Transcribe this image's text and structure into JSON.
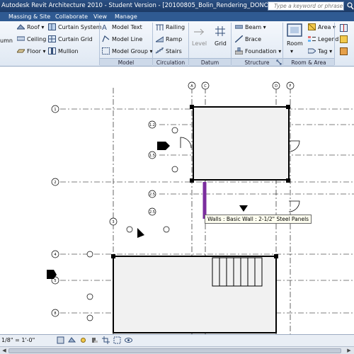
{
  "window": {
    "title": "Autodesk Revit Architecture 2010 - Student Version - [20100805_Bolin_Rendering_DONOTUSE - Structura",
    "search_placeholder": "Type a keyword or phrase"
  },
  "tabs": [
    {
      "label": "Massing & Site"
    },
    {
      "label": "Collaborate"
    },
    {
      "label": "View"
    },
    {
      "label": "Manage"
    }
  ],
  "ribbon": {
    "build": {
      "column": "umn",
      "roof": "Roof",
      "ceiling": "Ceiling",
      "floor": "Floor",
      "curtain_system": "Curtain System",
      "curtain_grid": "Curtain Grid",
      "mullion": "Mullion"
    },
    "model": {
      "model_text": "Model Text",
      "model_line": "Model Line",
      "model_group": "Model Group",
      "label": "Model"
    },
    "circulation": {
      "railing": "Railing",
      "ramp": "Ramp",
      "stairs": "Stairs",
      "label": "Circulation"
    },
    "datum": {
      "level": "Level",
      "grid": "Grid",
      "label": "Datum"
    },
    "structure": {
      "beam": "Beam",
      "brace": "Brace",
      "foundation": "Foundation",
      "label": "Structure"
    },
    "room_area": {
      "room": "Room",
      "area": "Area",
      "legend": "Legend",
      "tag": "Tag",
      "label": "Room & Area"
    }
  },
  "canvas": {
    "tooltip": "Walls : Basic Wall : 2-1/2\" Steel Panels",
    "grid_bubbles": [
      "A",
      "C",
      "D",
      "F",
      "1",
      "1.2",
      "1.5",
      "2",
      "2.5",
      "2.5",
      "3",
      "4",
      "5",
      "8"
    ]
  },
  "statusbar": {
    "scale": "1/8\" = 1'-0\""
  },
  "colors": {
    "title_bar": "#1c3a66",
    "tab_bar": "#2f5a92",
    "ribbon": "#dfe8f3",
    "highlighted_wall": "#7b2d9e"
  }
}
